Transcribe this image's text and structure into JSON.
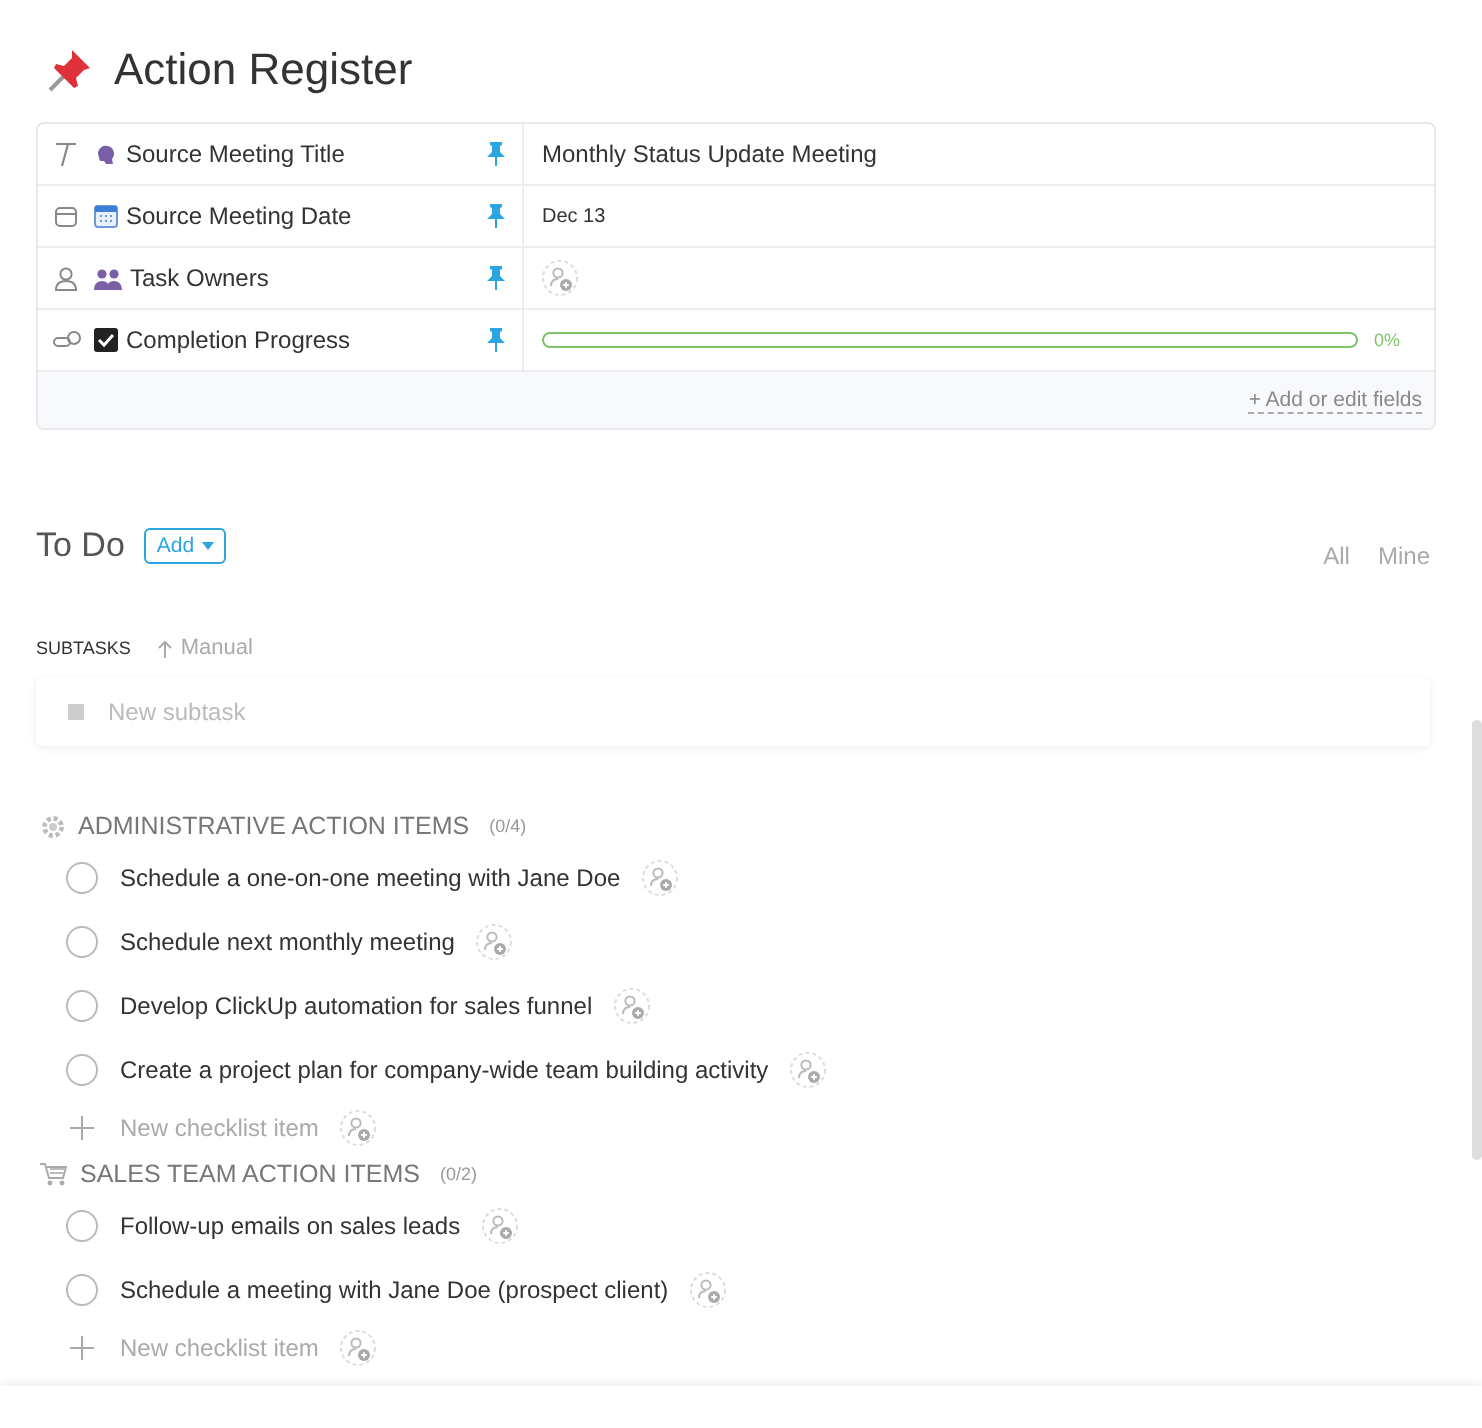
{
  "title": "Action Register",
  "fields": [
    {
      "kind": "text",
      "name": "Source Meeting Title",
      "value": "Monthly Status Update Meeting"
    },
    {
      "kind": "date",
      "name": "Source Meeting Date",
      "value": "Dec 13"
    },
    {
      "kind": "people",
      "name": "Task Owners"
    },
    {
      "kind": "progress",
      "name": "Completion Progress",
      "level": 0,
      "reading": "0%"
    }
  ],
  "add_fields": "+ Add or edit fields",
  "todo": {
    "title": "To Do",
    "add_button": "Add",
    "filters": [
      "All",
      "Mine"
    ]
  },
  "subtasks": {
    "label": "SUBTASKS",
    "sort": "Manual",
    "placeholder": "New subtask"
  },
  "checklists": [
    {
      "name": "ADMINISTRATIVE ACTION ITEMS",
      "count": "(0/4)",
      "items": [
        {
          "text": "Schedule a one-on-one meeting with Jane Doe",
          "checked": false
        },
        {
          "text": "Schedule next monthly meeting",
          "checked": false
        },
        {
          "text": "Develop ClickUp automation for sales funnel",
          "checked": false
        },
        {
          "text": "Create a project plan for company-wide team building activity",
          "checked": false
        }
      ],
      "new_item": "New checklist item"
    },
    {
      "name": "SALES TEAM ACTION ITEMS",
      "count": "(0/2)",
      "items": [
        {
          "text": "Follow-up emails on sales leads",
          "checked": false
        },
        {
          "text": "Schedule a meeting with Jane Doe (prospect client)",
          "checked": false
        }
      ],
      "new_item": "New checklist item"
    }
  ]
}
